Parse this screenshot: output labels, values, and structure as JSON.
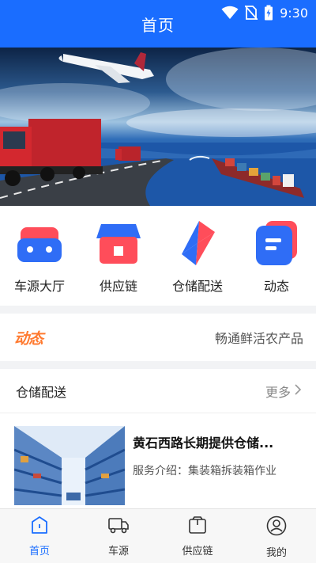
{
  "status": {
    "time": "9:30",
    "icons": [
      "wifi-icon",
      "no-sim-icon",
      "battery-charging-icon"
    ]
  },
  "header": {
    "title": "首页"
  },
  "banner": {
    "icon": "logistics-banner-image"
  },
  "quick_links": [
    {
      "label": "车源大厅",
      "icon": "truck-icon",
      "color": "#2f6df6",
      "accent": "#ff4d5a"
    },
    {
      "label": "供应链",
      "icon": "store-icon",
      "color": "#2f6df6",
      "accent": "#ff4d5a"
    },
    {
      "label": "仓储配送",
      "icon": "lightning-icon",
      "color": "#2f6df6",
      "accent": "#ff4d5a"
    },
    {
      "label": "动态",
      "icon": "message-icon",
      "color": "#2f6df6",
      "accent": "#ff4d5a"
    }
  ],
  "news": {
    "tag": "动态",
    "text": "畅通鲜活农产品",
    "tag_color": "#ff7a30"
  },
  "section": {
    "title": "仓储配送",
    "more": "更多",
    "items": [
      {
        "title": "黄石西路长期提供仓储...",
        "desc": "服务介绍：集装箱拆装箱作业"
      }
    ]
  },
  "tabs": [
    {
      "label": "首页",
      "icon": "home-icon",
      "active": true
    },
    {
      "label": "车源",
      "icon": "truck-outline-icon",
      "active": false
    },
    {
      "label": "供应链",
      "icon": "box-icon",
      "active": false
    },
    {
      "label": "我的",
      "icon": "user-icon",
      "active": false
    }
  ],
  "colors": {
    "primary": "#1a6dff",
    "accent_red": "#ff4d5a",
    "accent_orange": "#ff7a30"
  }
}
